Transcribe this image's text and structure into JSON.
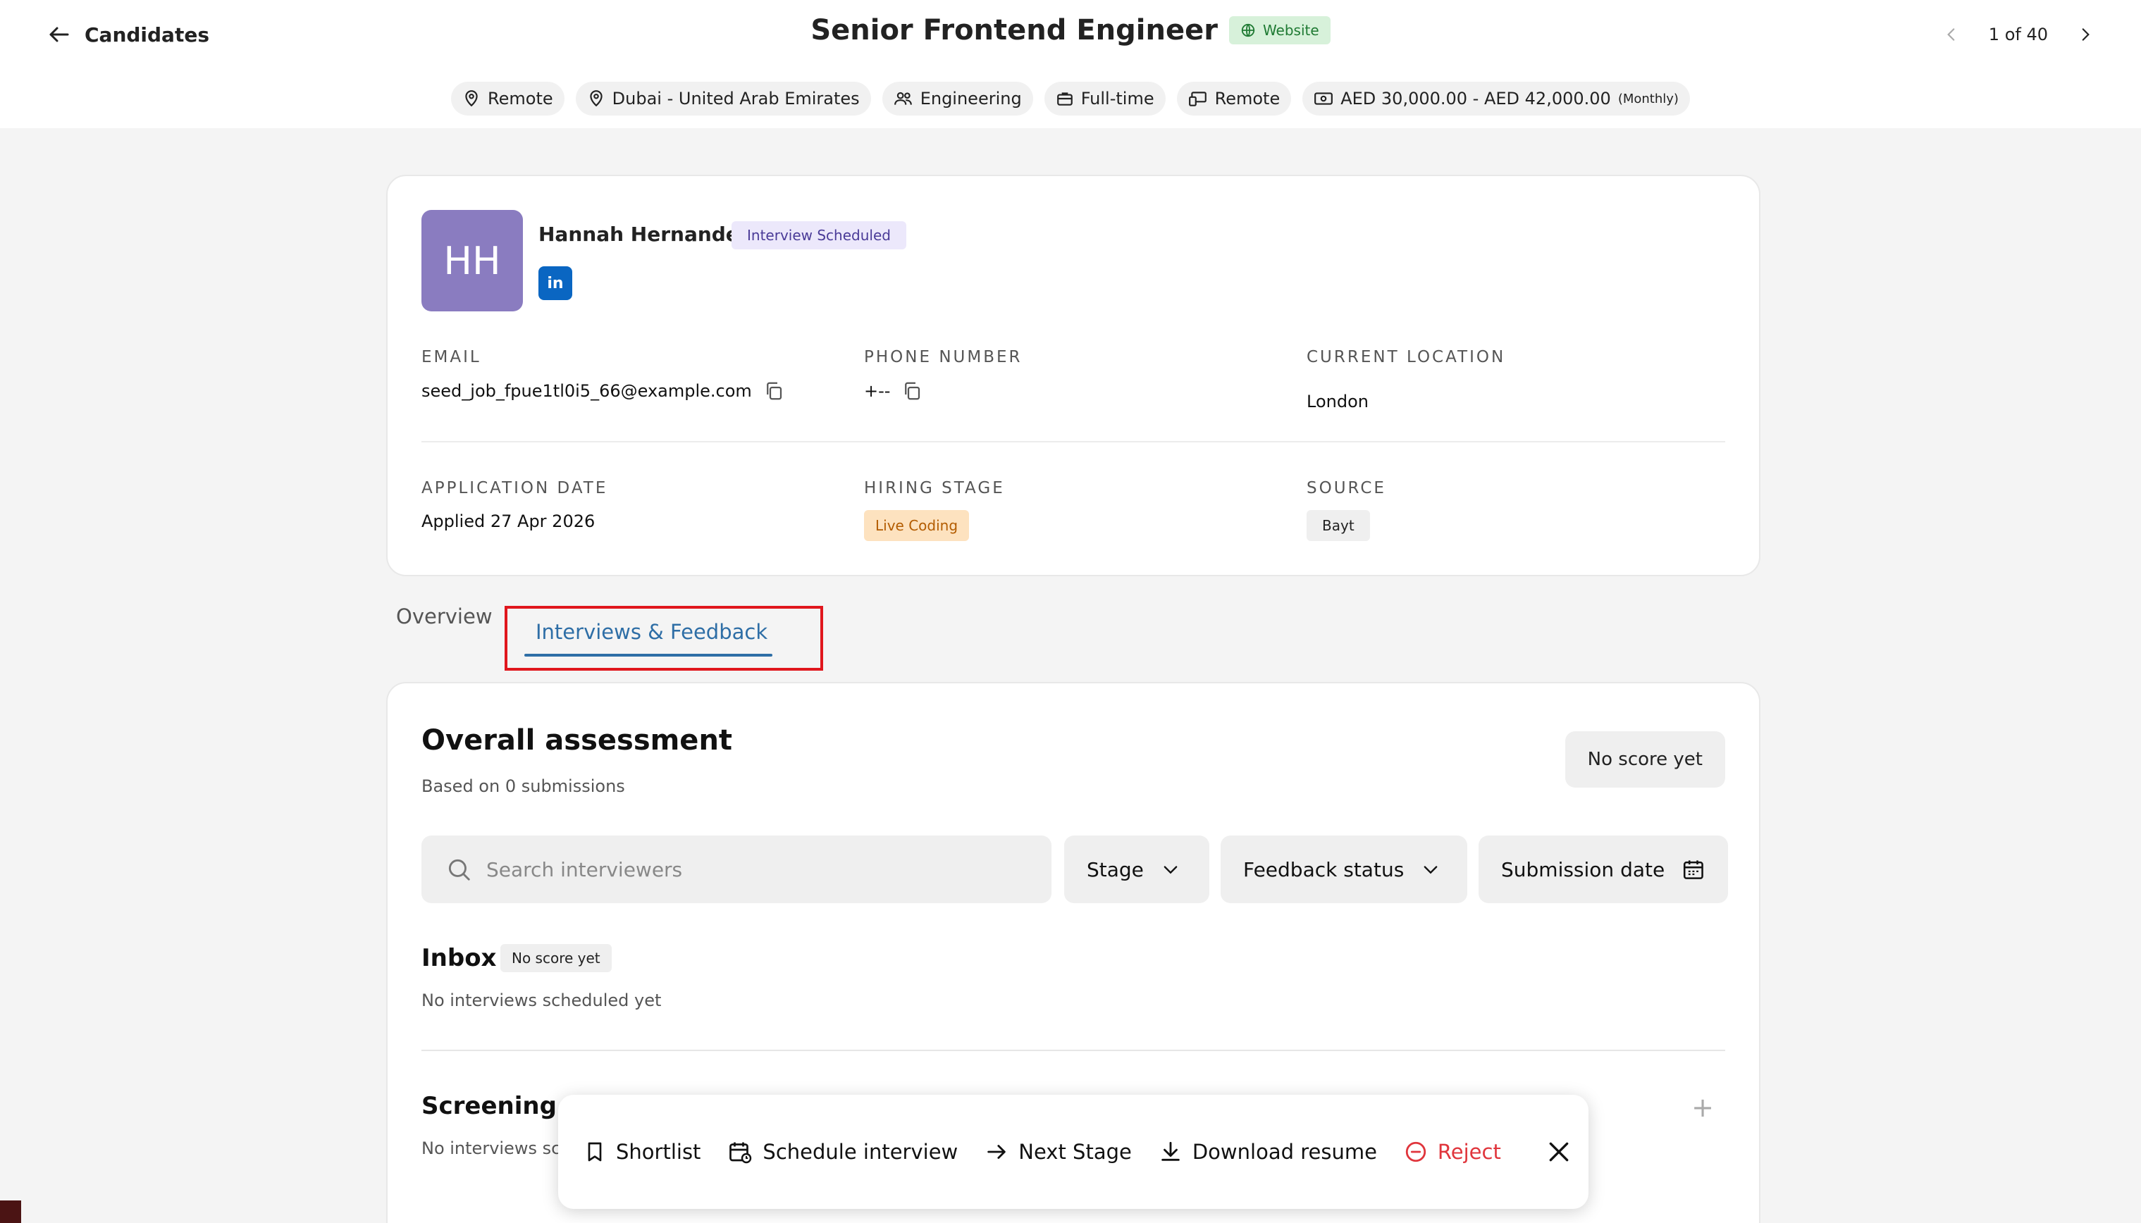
{
  "header": {
    "back_label": "Candidates",
    "job_title": "Senior Frontend Engineer",
    "website_badge": "Website",
    "pager": "1 of 40"
  },
  "chips": [
    {
      "icon": "pin-icon",
      "label": "Remote"
    },
    {
      "icon": "pin-icon",
      "label": "Dubai - United Arab Emirates"
    },
    {
      "icon": "people-icon",
      "label": "Engineering"
    },
    {
      "icon": "briefcase-icon",
      "label": "Full-time"
    },
    {
      "icon": "devices-icon",
      "label": "Remote"
    },
    {
      "icon": "money-icon",
      "label": "AED 30,000.00 - AED 42,000.00",
      "suffix": "(Monthly)"
    }
  ],
  "candidate": {
    "initials": "HH",
    "name": "Hannah Hernandez",
    "status": "Interview Scheduled",
    "linkedin": "in",
    "fields": {
      "email_label": "EMAIL",
      "email": "seed_job_fpue1tl0i5_66@example.com",
      "phone_label": "PHONE NUMBER",
      "phone": "+--",
      "location_label": "CURRENT LOCATION",
      "location": "London",
      "app_date_label": "APPLICATION DATE",
      "app_date": "Applied 27 Apr 2026",
      "stage_label": "HIRING STAGE",
      "stage": "Live Coding",
      "source_label": "SOURCE",
      "source": "Bayt"
    }
  },
  "tabs": {
    "overview": "Overview",
    "interviews": "Interviews & Feedback"
  },
  "assessment": {
    "title": "Overall assessment",
    "subtitle": "Based on 0 submissions",
    "score": "No score yet",
    "search_placeholder": "Search interviewers",
    "filters": {
      "stage": "Stage",
      "feedback": "Feedback status",
      "date": "Submission date"
    },
    "sections": [
      {
        "title": "Inbox",
        "badge": "No score yet",
        "empty": "No interviews scheduled yet"
      },
      {
        "title": "Screening ca",
        "badge": "",
        "empty": "No interviews sc"
      }
    ]
  },
  "actions": {
    "shortlist": "Shortlist",
    "schedule": "Schedule interview",
    "next_stage": "Next Stage",
    "download": "Download resume",
    "reject": "Reject"
  },
  "colors": {
    "accent": "#2e6ea6",
    "avatar": "#8a7cc0",
    "reject": "#e0353c",
    "highlight": "#e0161d"
  }
}
